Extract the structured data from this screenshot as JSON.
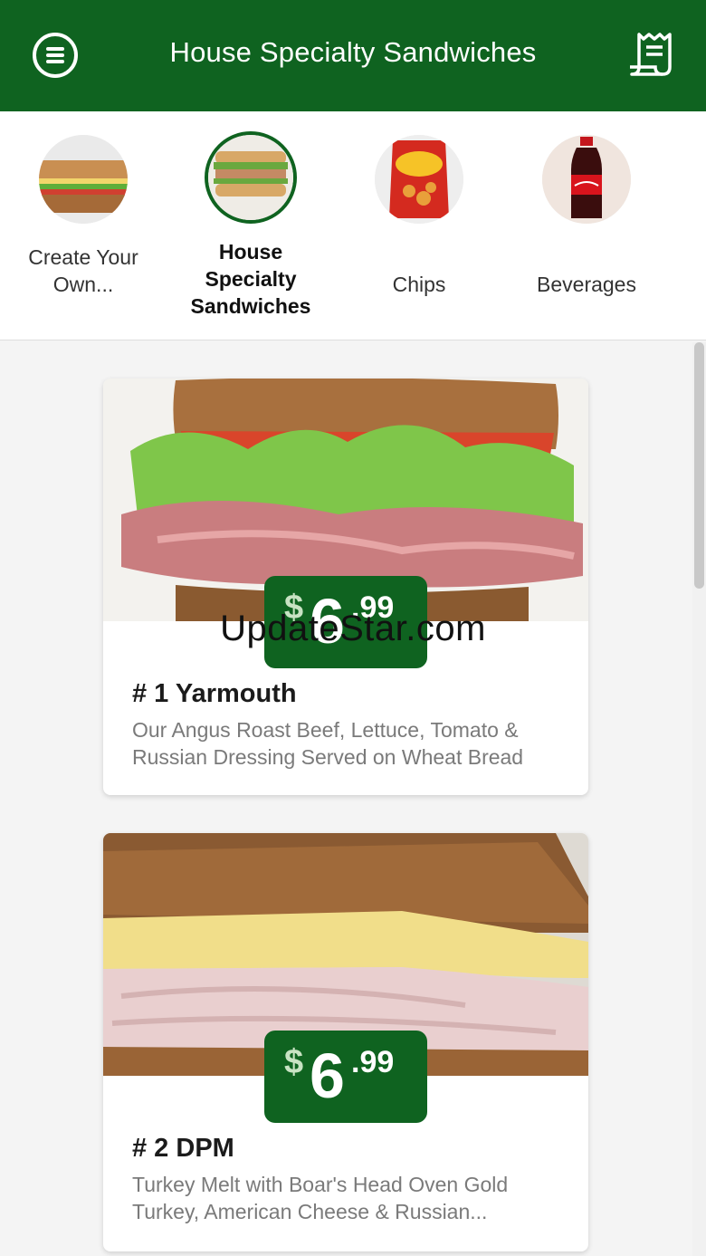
{
  "header": {
    "title": "House Specialty Sandwiches",
    "menu_icon": "hamburger-menu-icon",
    "receipt_icon": "receipt-icon"
  },
  "categories": [
    {
      "label": "Create Your Own...",
      "active": false
    },
    {
      "label": "House Specialty Sandwiches",
      "active": true
    },
    {
      "label": "Chips",
      "active": false
    },
    {
      "label": "Beverages",
      "active": false
    }
  ],
  "items": [
    {
      "price_dollar": "$",
      "price_whole": "6",
      "price_cents": ".99",
      "title": "# 1 Yarmouth",
      "description": "Our Angus Roast Beef, Lettuce, Tomato & Russian Dressing Served on Wheat Bread"
    },
    {
      "price_dollar": "$",
      "price_whole": "6",
      "price_cents": ".99",
      "title": "# 2 DPM",
      "description": "Turkey Melt with Boar's Head Oven Gold Turkey, American Cheese & Russian..."
    }
  ],
  "watermark": "UpdateStar.com",
  "colors": {
    "brand_green": "#0f6320"
  }
}
